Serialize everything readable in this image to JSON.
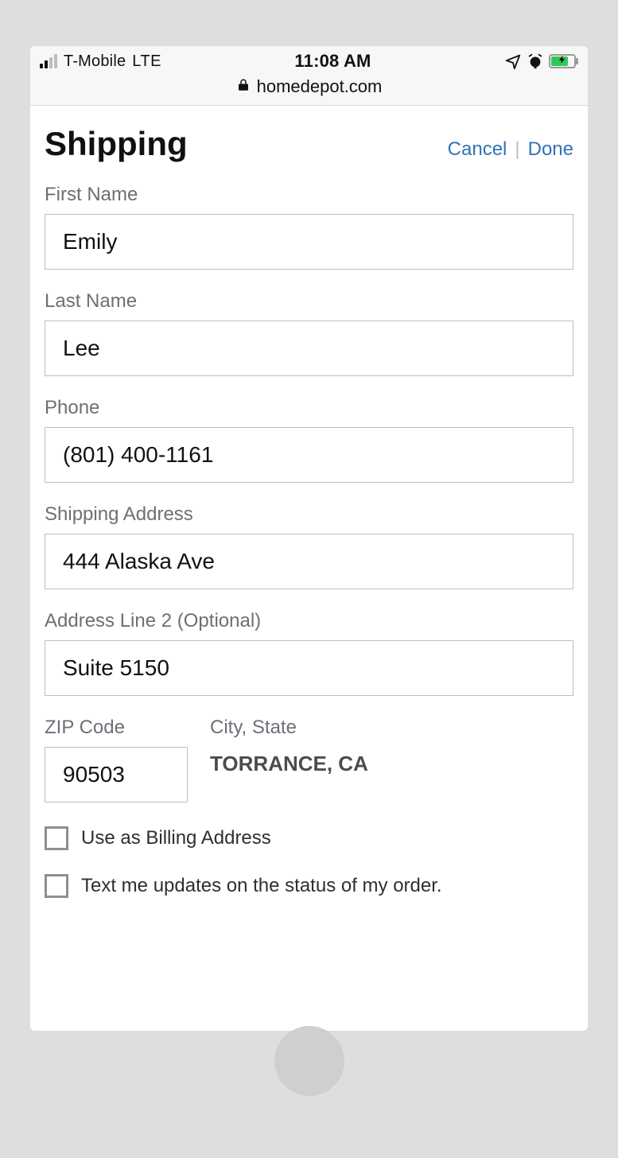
{
  "statusbar": {
    "carrier": "T-Mobile",
    "network": "LTE",
    "time": "11:08 AM",
    "battery_percent": 70,
    "battery_charging": true
  },
  "browser": {
    "domain": "homedepot.com"
  },
  "header": {
    "title": "Shipping",
    "cancel_label": "Cancel",
    "separator": "|",
    "done_label": "Done"
  },
  "form": {
    "first_name": {
      "label": "First Name",
      "value": "Emily"
    },
    "last_name": {
      "label": "Last Name",
      "value": "Lee"
    },
    "phone": {
      "label": "Phone",
      "value": "(801) 400-1161"
    },
    "address1": {
      "label": "Shipping Address",
      "value": "444 Alaska Ave"
    },
    "address2": {
      "label": "Address Line 2 (Optional)",
      "value": "Suite 5150"
    },
    "zip": {
      "label": "ZIP Code",
      "value": "90503"
    },
    "city_state": {
      "label": "City, State",
      "value": "TORRANCE, CA"
    },
    "use_as_billing_label": "Use as Billing Address",
    "text_updates_label": "Text me updates on the status of my order."
  }
}
